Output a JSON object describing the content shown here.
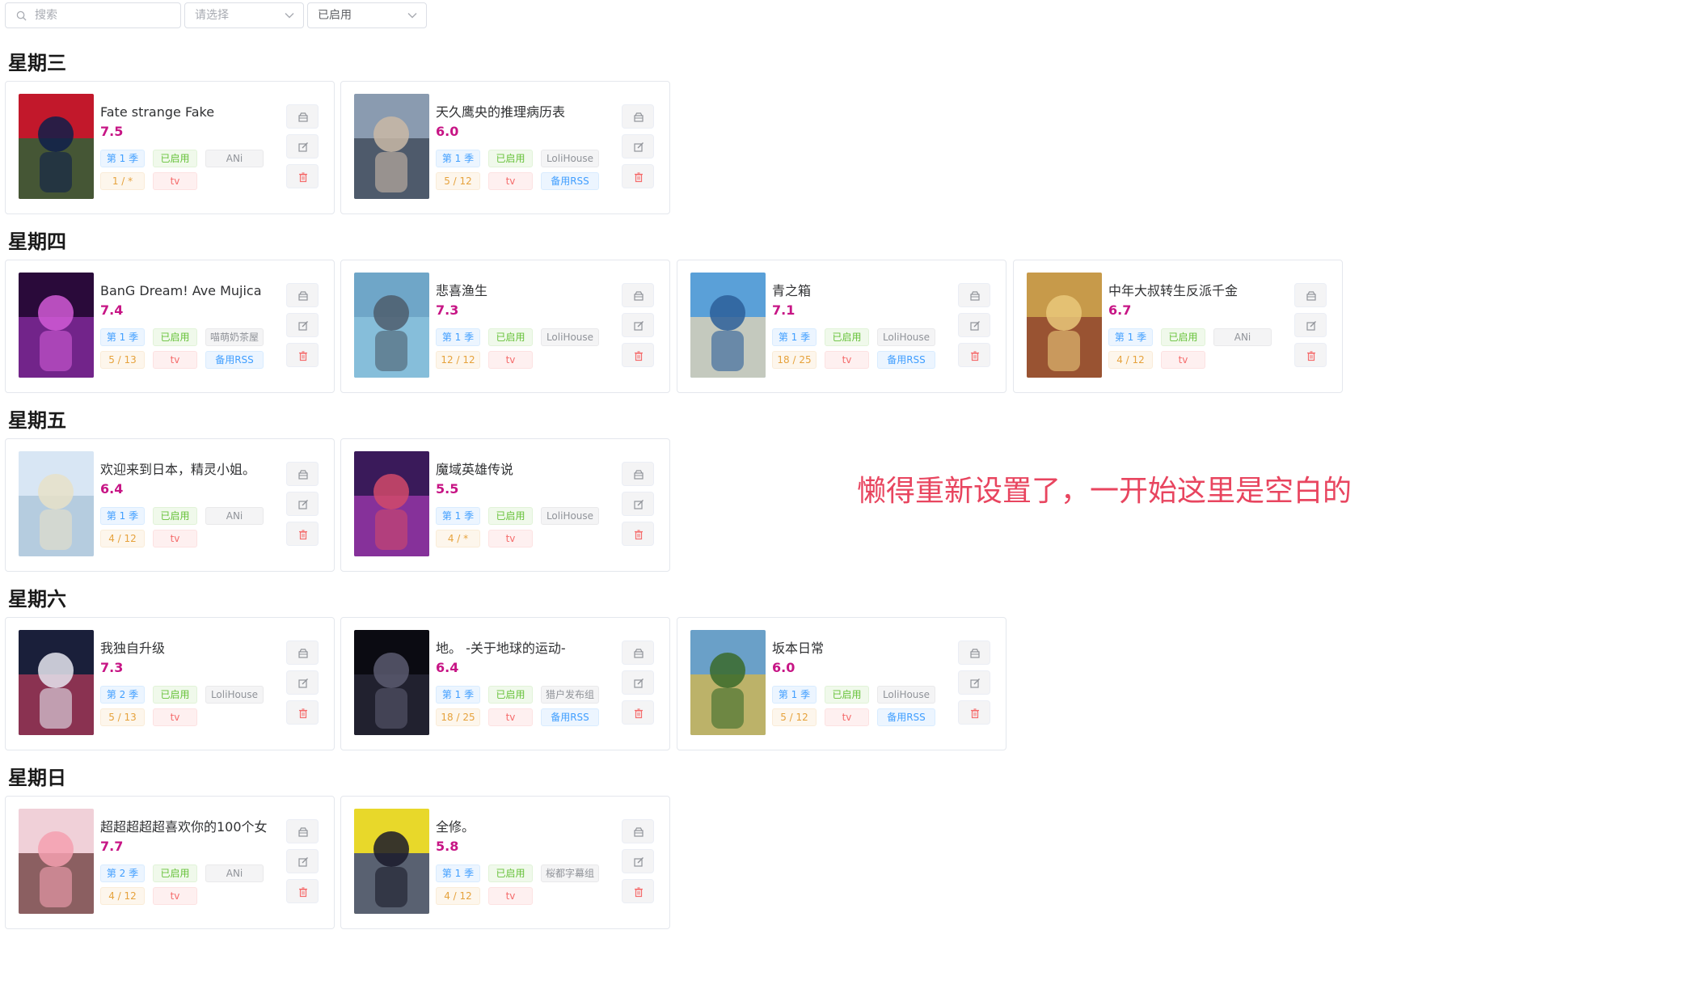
{
  "filters": {
    "search_placeholder": "搜索",
    "select1_placeholder": "请选择",
    "select2_value": "已启用"
  },
  "days": [
    {
      "label": "星期三",
      "cards": [
        {
          "title": "Fate strange Fake",
          "score": "7.5",
          "season": "第 1 季",
          "status": "已启用",
          "group": "ANi",
          "episodes": "1 / *",
          "type": "tv",
          "rss": ""
        },
        {
          "title": "天久鹰央的推理病历表",
          "score": "6.0",
          "season": "第 1 季",
          "status": "已启用",
          "group": "LoliHouse",
          "episodes": "5 / 12",
          "type": "tv",
          "rss": "备用RSS"
        }
      ]
    },
    {
      "label": "星期四",
      "cards": [
        {
          "title": "BanG Dream! Ave Mujica",
          "score": "7.4",
          "season": "第 1 季",
          "status": "已启用",
          "group": "喵萌奶茶屋",
          "episodes": "5 / 13",
          "type": "tv",
          "rss": "备用RSS"
        },
        {
          "title": "悲喜渔生",
          "score": "7.3",
          "season": "第 1 季",
          "status": "已启用",
          "group": "LoliHouse",
          "episodes": "12 / 12",
          "type": "tv",
          "rss": ""
        },
        {
          "title": "青之箱",
          "score": "7.1",
          "season": "第 1 季",
          "status": "已启用",
          "group": "LoliHouse",
          "episodes": "18 / 25",
          "type": "tv",
          "rss": "备用RSS"
        },
        {
          "title": "中年大叔转生反派千金",
          "score": "6.7",
          "season": "第 1 季",
          "status": "已启用",
          "group": "ANi",
          "episodes": "4 / 12",
          "type": "tv",
          "rss": ""
        }
      ]
    },
    {
      "label": "星期五",
      "cards": [
        {
          "title": "欢迎来到日本，精灵小姐。",
          "score": "6.4",
          "season": "第 1 季",
          "status": "已启用",
          "group": "ANi",
          "episodes": "4 / 12",
          "type": "tv",
          "rss": ""
        },
        {
          "title": "魔域英雄传说",
          "score": "5.5",
          "season": "第 1 季",
          "status": "已启用",
          "group": "LoliHouse",
          "episodes": "4 / *",
          "type": "tv",
          "rss": ""
        }
      ]
    },
    {
      "label": "星期六",
      "cards": [
        {
          "title": "我独自升级",
          "score": "7.3",
          "season": "第 2 季",
          "status": "已启用",
          "group": "LoliHouse",
          "episodes": "5 / 13",
          "type": "tv",
          "rss": ""
        },
        {
          "title": "地。 -关于地球的运动-",
          "score": "6.4",
          "season": "第 1 季",
          "status": "已启用",
          "group": "猎户发布组",
          "episodes": "18 / 25",
          "type": "tv",
          "rss": "备用RSS"
        },
        {
          "title": "坂本日常",
          "score": "6.0",
          "season": "第 1 季",
          "status": "已启用",
          "group": "LoliHouse",
          "episodes": "5 / 12",
          "type": "tv",
          "rss": "备用RSS"
        }
      ]
    },
    {
      "label": "星期日",
      "cards": [
        {
          "title": "超超超超超喜欢你的100个女",
          "score": "7.7",
          "season": "第 2 季",
          "status": "已启用",
          "group": "ANi",
          "episodes": "4 / 12",
          "type": "tv",
          "rss": ""
        },
        {
          "title": "全修。",
          "score": "5.8",
          "season": "第 1 季",
          "status": "已启用",
          "group": "桜都字幕组",
          "episodes": "4 / 12",
          "type": "tv",
          "rss": ""
        }
      ]
    }
  ],
  "annotation": "懒得重新设置了，一开始这里是空白的",
  "icons": {
    "search": "search-icon",
    "dropdown": "chevron-down-icon",
    "archive": "archive-icon",
    "edit": "edit-icon",
    "delete": "trash-icon"
  },
  "colors": {
    "score": "#c71585",
    "annotation": "#e8455f",
    "season_tag": "#409eff",
    "status_tag": "#67c23a",
    "episodes_tag": "#e6a23c",
    "type_tag": "#f56c6c"
  }
}
